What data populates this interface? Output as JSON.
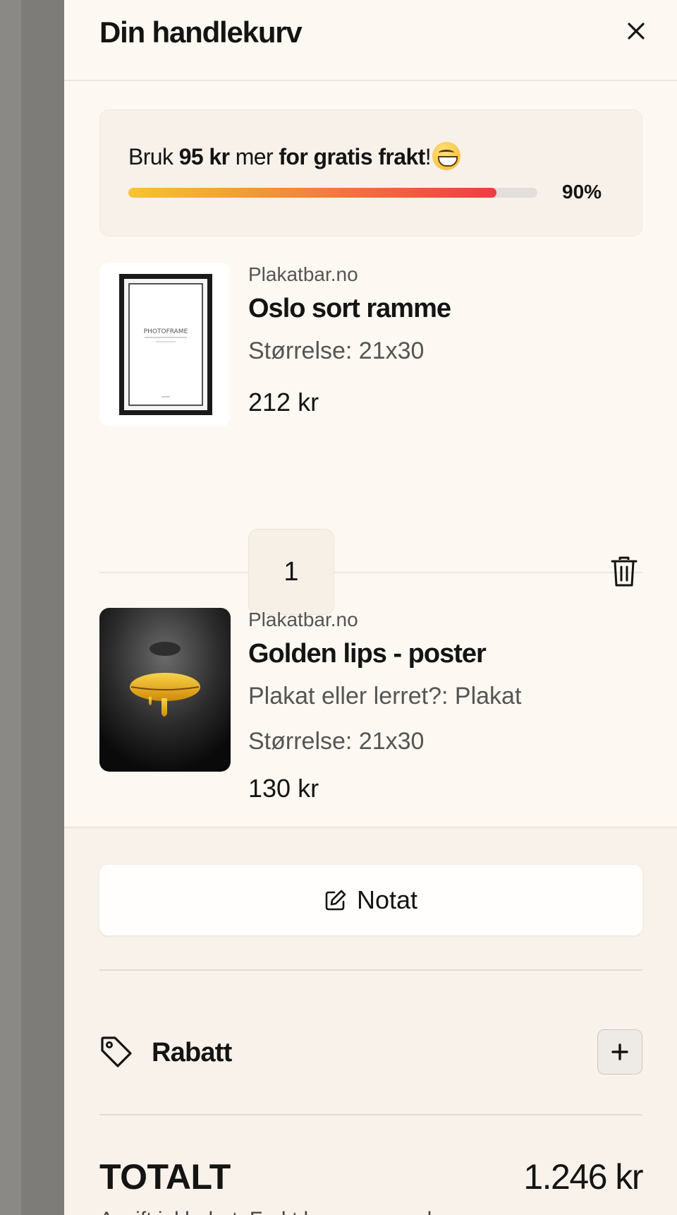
{
  "cart": {
    "title": "Din handlekurv"
  },
  "shipping": {
    "prefix": "Bruk",
    "amount": "95 kr",
    "middle": "mer",
    "goal": "for gratis frakt",
    "suffix": "!",
    "progress_percent": 90,
    "progress_label": "90%",
    "gradient_colors": [
      "#f8c332",
      "#f28a3a",
      "#ec3c44"
    ]
  },
  "items": [
    {
      "vendor": "Plakatbar.no",
      "name": "Oslo sort ramme",
      "options": [
        "Størrelse: 21x30"
      ],
      "price": "212 kr",
      "quantity": "1",
      "image_text": "PHOTOFRAME"
    },
    {
      "vendor": "Plakatbar.no",
      "name": "Golden lips - poster",
      "options": [
        "Plakat eller lerret?: Plakat",
        "Størrelse: 21x30"
      ],
      "price": "130 kr"
    }
  ],
  "note": {
    "label": "Notat"
  },
  "discount": {
    "label": "Rabatt"
  },
  "totals": {
    "label": "TOTALT",
    "value": "1.246 kr",
    "taxes_note": "Avgift inkludert. Frakt beregnes ved"
  },
  "colors": {
    "drawer_bg": "#fdf8f2",
    "footer_bg": "#f8f2eb",
    "text": "#141414"
  }
}
